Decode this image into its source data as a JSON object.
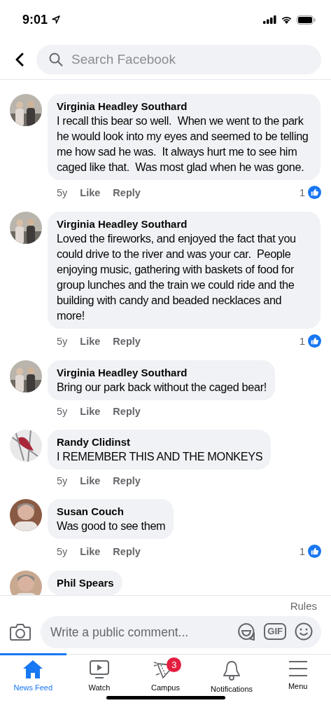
{
  "status_bar": {
    "time": "9:01"
  },
  "header": {
    "search": {
      "placeholder": "Search Facebook"
    }
  },
  "comments": [
    {
      "name": "Virginia Headley Southard",
      "text": "I recall this bear so well.  When we went to the park he would look into my eyes and seemed to be telling me how sad he was.  It always hurt me to see him caged like that.  Was most glad when he was gone.",
      "time": "5y",
      "like": "Like",
      "reply": "Reply",
      "reactions": "1"
    },
    {
      "name": "Virginia Headley Southard",
      "text": "Loved the fireworks, and enjoyed the fact that you could drive to the river and was your car.  People enjoying music, gathering with baskets of food for group lunches and the train we could ride and the building with candy and beaded necklaces and more!",
      "time": "5y",
      "like": "Like",
      "reply": "Reply",
      "reactions": "1"
    },
    {
      "name": "Virginia Headley Southard",
      "text": "Bring our park back without the caged bear!",
      "time": "5y",
      "like": "Like",
      "reply": "Reply"
    },
    {
      "name": "Randy Clidinst",
      "text": "I REMEMBER THIS AND THE MONKEYS",
      "time": "5y",
      "like": "Like",
      "reply": "Reply"
    },
    {
      "name": "Susan Couch",
      "text": "Was good to see them",
      "time": "5y",
      "like": "Like",
      "reply": "Reply",
      "reactions": "1"
    },
    {
      "name": "Phil Spears"
    }
  ],
  "composer": {
    "rules": "Rules",
    "placeholder": "Write a public comment...",
    "gif": "GIF"
  },
  "tab_bar": [
    {
      "label": "News Feed",
      "kind": "home",
      "selected": true
    },
    {
      "label": "Watch",
      "kind": "watch",
      "selected": false
    },
    {
      "label": "Campus",
      "kind": "campus",
      "selected": false,
      "badge": "3"
    },
    {
      "label": "Notifications",
      "kind": "bell",
      "selected": false
    },
    {
      "label": "Menu",
      "kind": "menu",
      "selected": false
    }
  ]
}
